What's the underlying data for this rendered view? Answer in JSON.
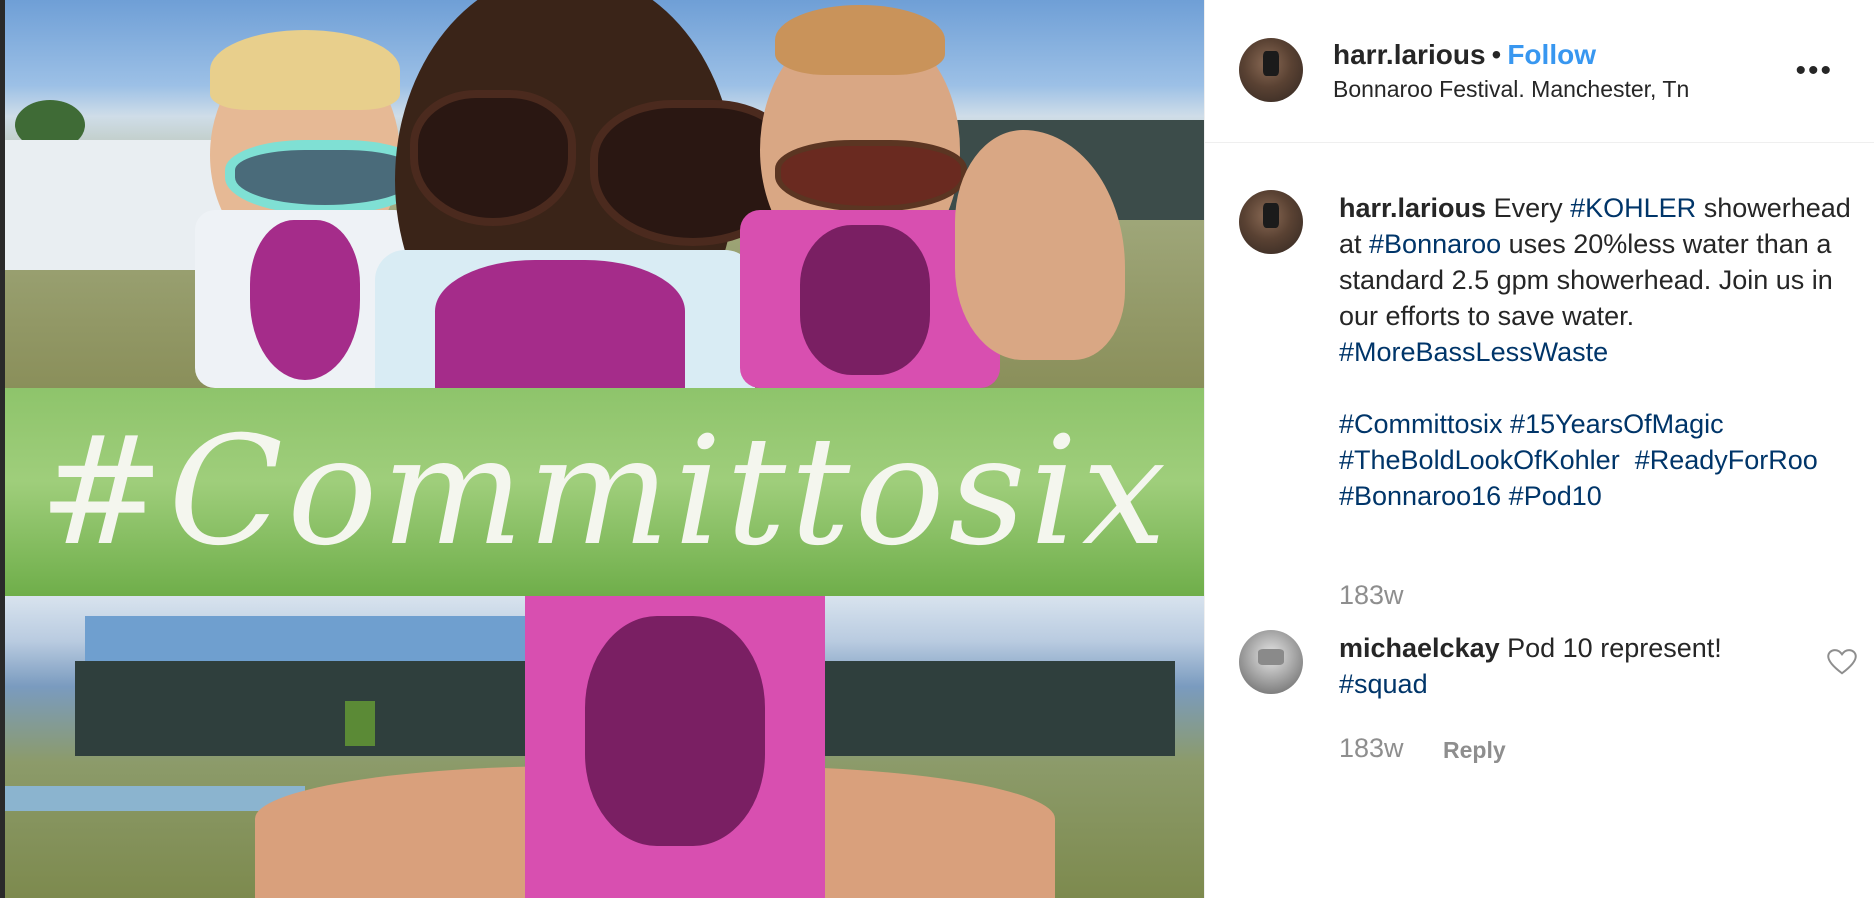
{
  "post": {
    "photo_overlay_text": "#Committosix",
    "author": {
      "username": "harr.larious",
      "separator": "•",
      "follow_label": "Follow",
      "location": "Bonnaroo Festival. Manchester, Tn"
    },
    "more_icon": "more-horizontal-icon",
    "caption": {
      "username": "harr.larious",
      "parts": {
        "t1": "Every ",
        "h1": "#KOHLER",
        "t2": "showerhead at ",
        "h2": "#Bonnaroo",
        "t3": " uses 20%less water than a standard 2.5 gpm showerhead. Join us in our efforts to save water.",
        "h3": "#MoreBassLessWaste",
        "h4": "#Committosix",
        "h5": "#15YearsOfMagic",
        "h6": "#TheBoldLookOfKohler",
        "h7": "#ReadyForRoo",
        "h8": "#Bonnaroo16",
        "h9": "#Pod10"
      },
      "time": "183w"
    },
    "comments": [
      {
        "username": "michaelckay",
        "text": " Pod 10 represent!",
        "hashtag": "#squad",
        "time": "183w",
        "reply_label": "Reply",
        "like_icon": "heart-icon"
      }
    ]
  },
  "colors": {
    "link": "#3897f0",
    "hashtag": "#003569",
    "muted": "#8e8e8e",
    "text": "#262626"
  }
}
